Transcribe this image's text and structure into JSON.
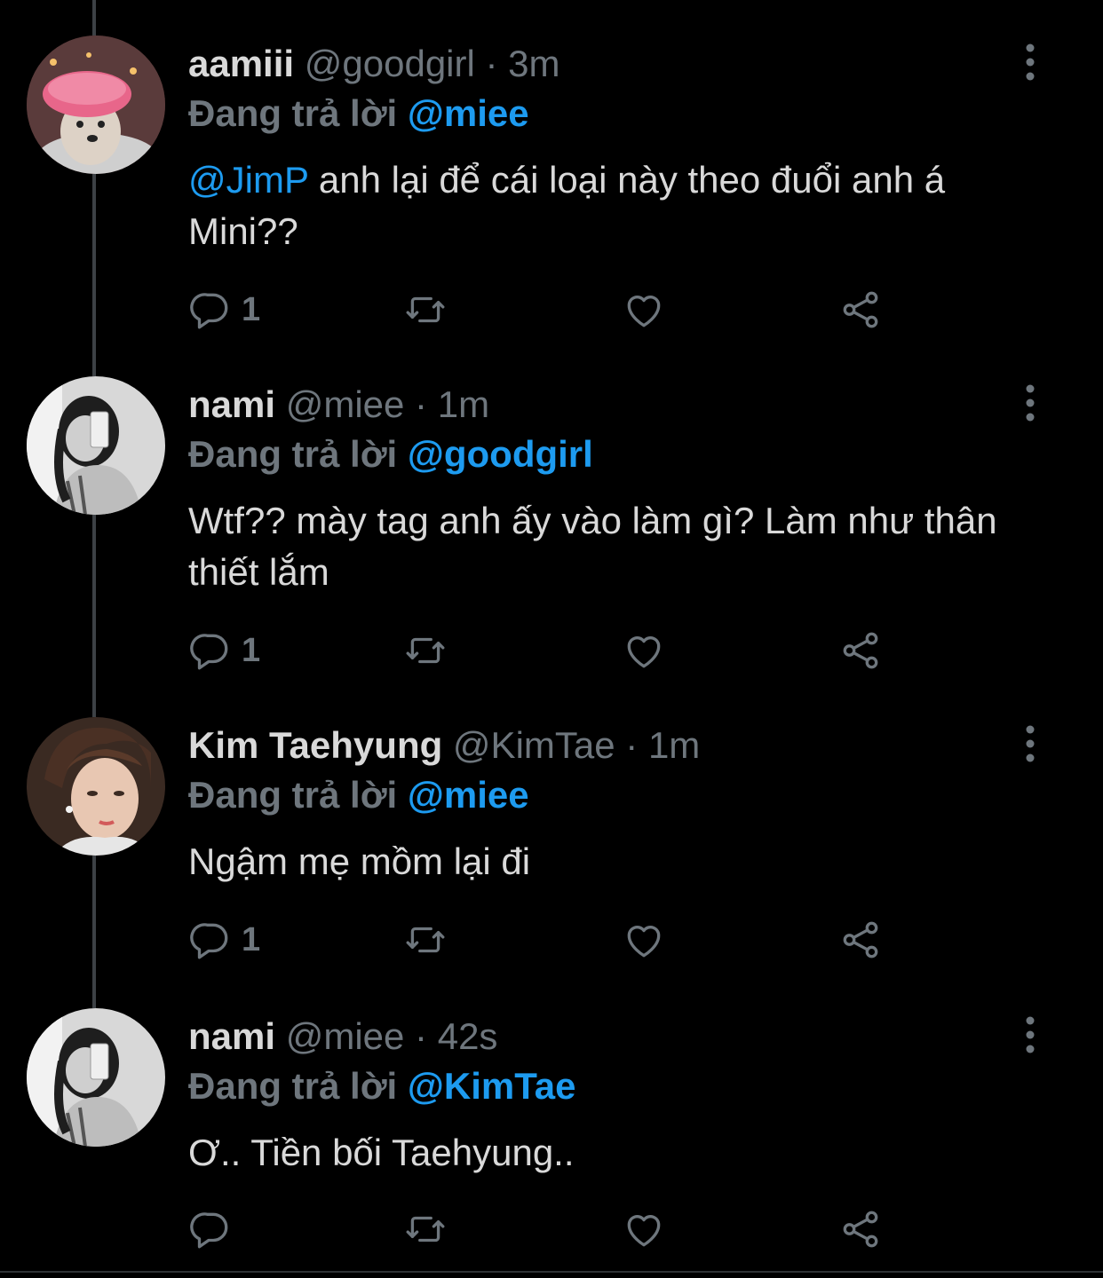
{
  "replying_label": "Đang trả lời",
  "tweets": [
    {
      "name": "aamiii",
      "handle": "@goodgirl",
      "separator": "·",
      "time": "3m",
      "reply_to": "@miee",
      "mention": "@JimP",
      "text": " anh lại để cái loại này theo đuổi anh á Mini??",
      "reply_count": "1",
      "avatar": "dog-in-pink-shower-cap"
    },
    {
      "name": "nami",
      "handle": "@miee",
      "separator": "·",
      "time": "1m",
      "reply_to": "@goodgirl",
      "mention": "",
      "text": "Wtf?? mày tag anh ấy vào làm gì? Làm như thân thiết lắm",
      "reply_count": "1",
      "avatar": "grayscale-girl-selfie"
    },
    {
      "name": "Kim Taehyung",
      "handle": "@KimTae",
      "separator": "·",
      "time": "1m",
      "reply_to": "@miee",
      "mention": "",
      "text": "Ngậm mẹ mồm lại đi",
      "reply_count": "1",
      "avatar": "young-man-portrait"
    },
    {
      "name": "nami",
      "handle": "@miee",
      "separator": "·",
      "time": "42s",
      "reply_to": "@KimTae",
      "mention": "",
      "text": "Ơ.. Tiền bối Taehyung..",
      "reply_count": "",
      "avatar": "grayscale-girl-selfie"
    }
  ],
  "icons": {
    "reply": "reply-icon",
    "retweet": "retweet-icon",
    "like": "heart-icon",
    "share": "share-icon",
    "more": "more-vertical-icon"
  },
  "colors": {
    "background": "#000000",
    "text": "#d9d9d9",
    "muted": "#6e767d",
    "link": "#1d9bf0",
    "thread_line": "#3d4145"
  }
}
